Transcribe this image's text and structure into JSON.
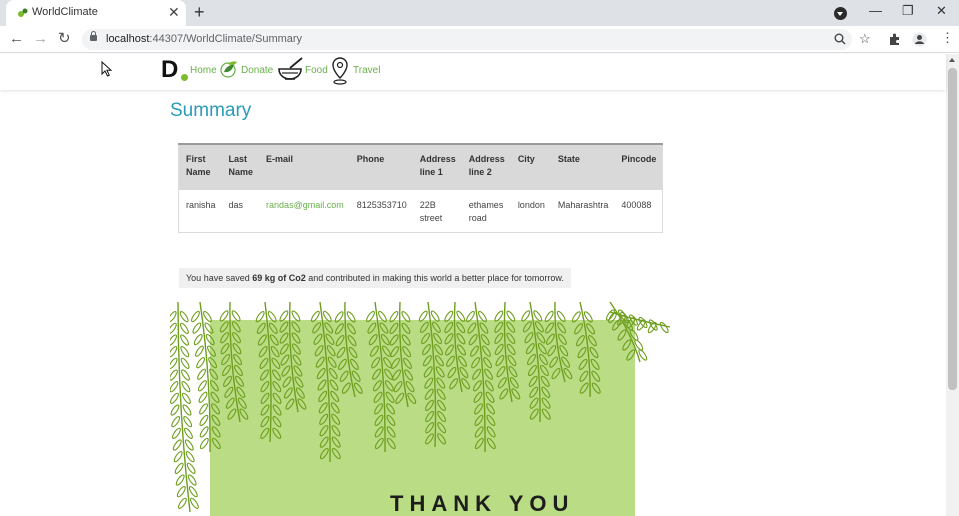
{
  "browser": {
    "tab_title": "WorldClimate",
    "url_host": "localhost",
    "url_path": ":44307/WorldClimate/Summary"
  },
  "site_nav": {
    "logo": "D",
    "links": [
      "Home",
      "Donate",
      "Food",
      "Travel"
    ]
  },
  "summary": {
    "title": "Summary",
    "table": {
      "headers": [
        [
          "First",
          "Name"
        ],
        [
          "Last",
          "Name"
        ],
        [
          "E-mail",
          ""
        ],
        [
          "Phone",
          ""
        ],
        [
          "Address",
          "line 1"
        ],
        [
          "Address",
          "line 2"
        ],
        [
          "City",
          ""
        ],
        [
          "State",
          ""
        ],
        [
          "Pincode",
          ""
        ]
      ],
      "row": {
        "first_name": "ranisha",
        "last_name": "das",
        "email": "randas@gmail.com",
        "phone": "8125353710",
        "address1_a": "22B",
        "address1_b": "street",
        "address2_a": "ethames",
        "address2_b": "road",
        "city": "london",
        "state": "Maharashtra",
        "pincode": "400088"
      }
    },
    "co2": {
      "prefix": "You have saved ",
      "amount": "69 kg of Co2",
      "suffix": " and contributed in making this world a better place for tomorrow."
    },
    "card_text": "THANK YOU"
  },
  "colors": {
    "accent_teal": "#2a9bb8",
    "link_green": "#6ab04c",
    "card_green": "#b9dc84",
    "leaf_green": "#6e9e1e"
  }
}
